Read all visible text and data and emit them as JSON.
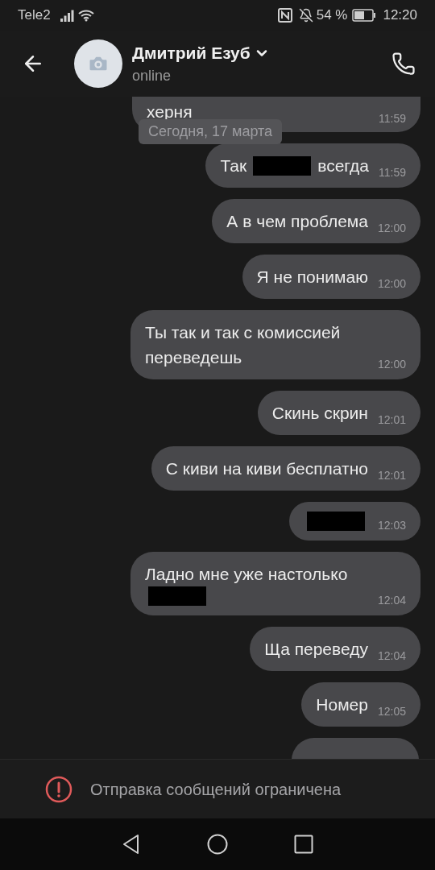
{
  "status_bar": {
    "carrier": "Tele2",
    "battery_percent": "54 %",
    "time": "12:20"
  },
  "header": {
    "name": "Дмитрий Езуб",
    "status": "online"
  },
  "date_badge": "Сегодня, 17 марта",
  "messages": [
    {
      "kind": "message",
      "parts": [
        {
          "kind": "text",
          "text": "херня"
        }
      ],
      "time": "11:59",
      "clipped": true
    },
    {
      "kind": "message",
      "parts": [
        {
          "kind": "text",
          "text": "Так"
        },
        {
          "kind": "redacted"
        },
        {
          "kind": "text",
          "text": "всегда"
        }
      ],
      "time": "11:59"
    },
    {
      "kind": "message",
      "parts": [
        {
          "kind": "text",
          "text": "А в чем проблема"
        }
      ],
      "time": "12:00"
    },
    {
      "kind": "message",
      "parts": [
        {
          "kind": "text",
          "text": "Я не понимаю"
        }
      ],
      "time": "12:00"
    },
    {
      "kind": "message",
      "parts": [
        {
          "kind": "text",
          "text": "Ты так и так с комиссией переведешь"
        }
      ],
      "time": "12:00"
    },
    {
      "kind": "message",
      "parts": [
        {
          "kind": "text",
          "text": "Скинь скрин"
        }
      ],
      "time": "12:01"
    },
    {
      "kind": "message",
      "parts": [
        {
          "kind": "text",
          "text": "С киви на киви бесплатно"
        }
      ],
      "time": "12:01"
    },
    {
      "kind": "message",
      "parts": [
        {
          "kind": "redacted"
        }
      ],
      "time": "12:03"
    },
    {
      "kind": "message",
      "parts": [
        {
          "kind": "text",
          "text": "Ладно мне уже настолько"
        },
        {
          "kind": "redacted"
        }
      ],
      "time": "12:04"
    },
    {
      "kind": "message",
      "parts": [
        {
          "kind": "text",
          "text": "Ща переведу"
        }
      ],
      "time": "12:04"
    },
    {
      "kind": "message",
      "parts": [
        {
          "kind": "text",
          "text": "Номер"
        }
      ],
      "time": "12:05"
    },
    {
      "kind": "clipped"
    }
  ],
  "notice": "Отправка сообщений ограничена"
}
